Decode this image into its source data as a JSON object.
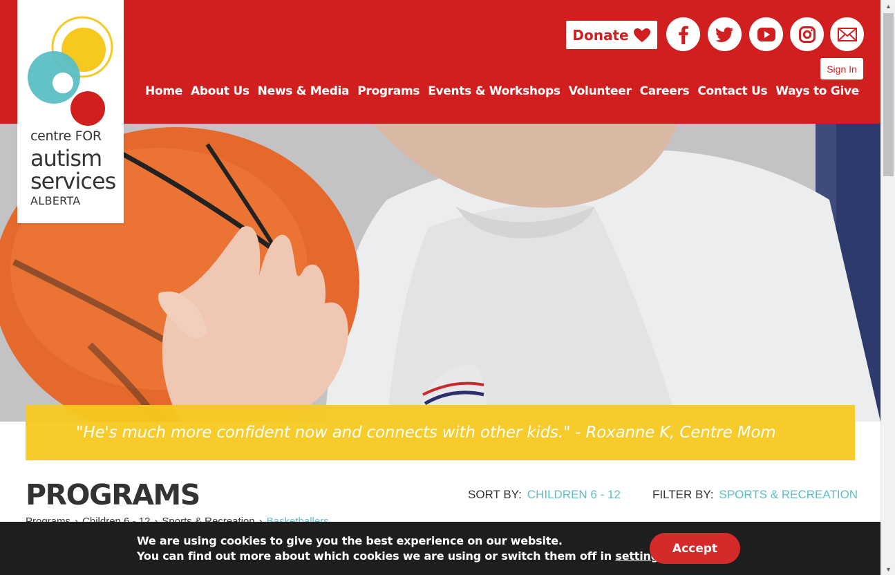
{
  "header": {
    "logo": {
      "line1": "centre FOR",
      "line2": "autism",
      "line3": "services",
      "line4": "ALBERTA"
    },
    "donate_label": "Donate",
    "sign_in_label": "Sign In",
    "social": [
      "facebook-icon",
      "twitter-icon",
      "youtube-icon",
      "instagram-icon",
      "email-icon"
    ],
    "nav": [
      {
        "label": "Home"
      },
      {
        "label": "About Us"
      },
      {
        "label": "News & Media"
      },
      {
        "label": "Programs"
      },
      {
        "label": "Events & Workshops"
      },
      {
        "label": "Volunteer"
      },
      {
        "label": "Careers"
      },
      {
        "label": "Contact Us"
      },
      {
        "label": "Ways to Give"
      }
    ]
  },
  "hero": {
    "quote": "\"He's much more confident now and connects with other kids.\" - Roxanne K, Centre Mom"
  },
  "programs": {
    "title": "PROGRAMS",
    "sort_label": "SORT BY:",
    "sort_value": "CHILDREN 6 - 12",
    "filter_label": "FILTER BY:",
    "filter_value": "SPORTS & RECREATION",
    "breadcrumb": [
      "Programs",
      "Children 6 - 12",
      "Sports & Recreation",
      "Basketballers"
    ]
  },
  "cookie": {
    "line1": "We are using cookies to give you the best experience on our website.",
    "line2_prefix": "You can find out more about which cookies we are using or switch them off in",
    "line2_link": "settings",
    "line2_suffix": ".",
    "accept_label": "Accept"
  },
  "colors": {
    "brand_red": "#d11f1f",
    "quote_yellow": "#f7c81e",
    "accent_teal": "#5bbfc5",
    "cookie_bg": "#1e1e1e"
  }
}
